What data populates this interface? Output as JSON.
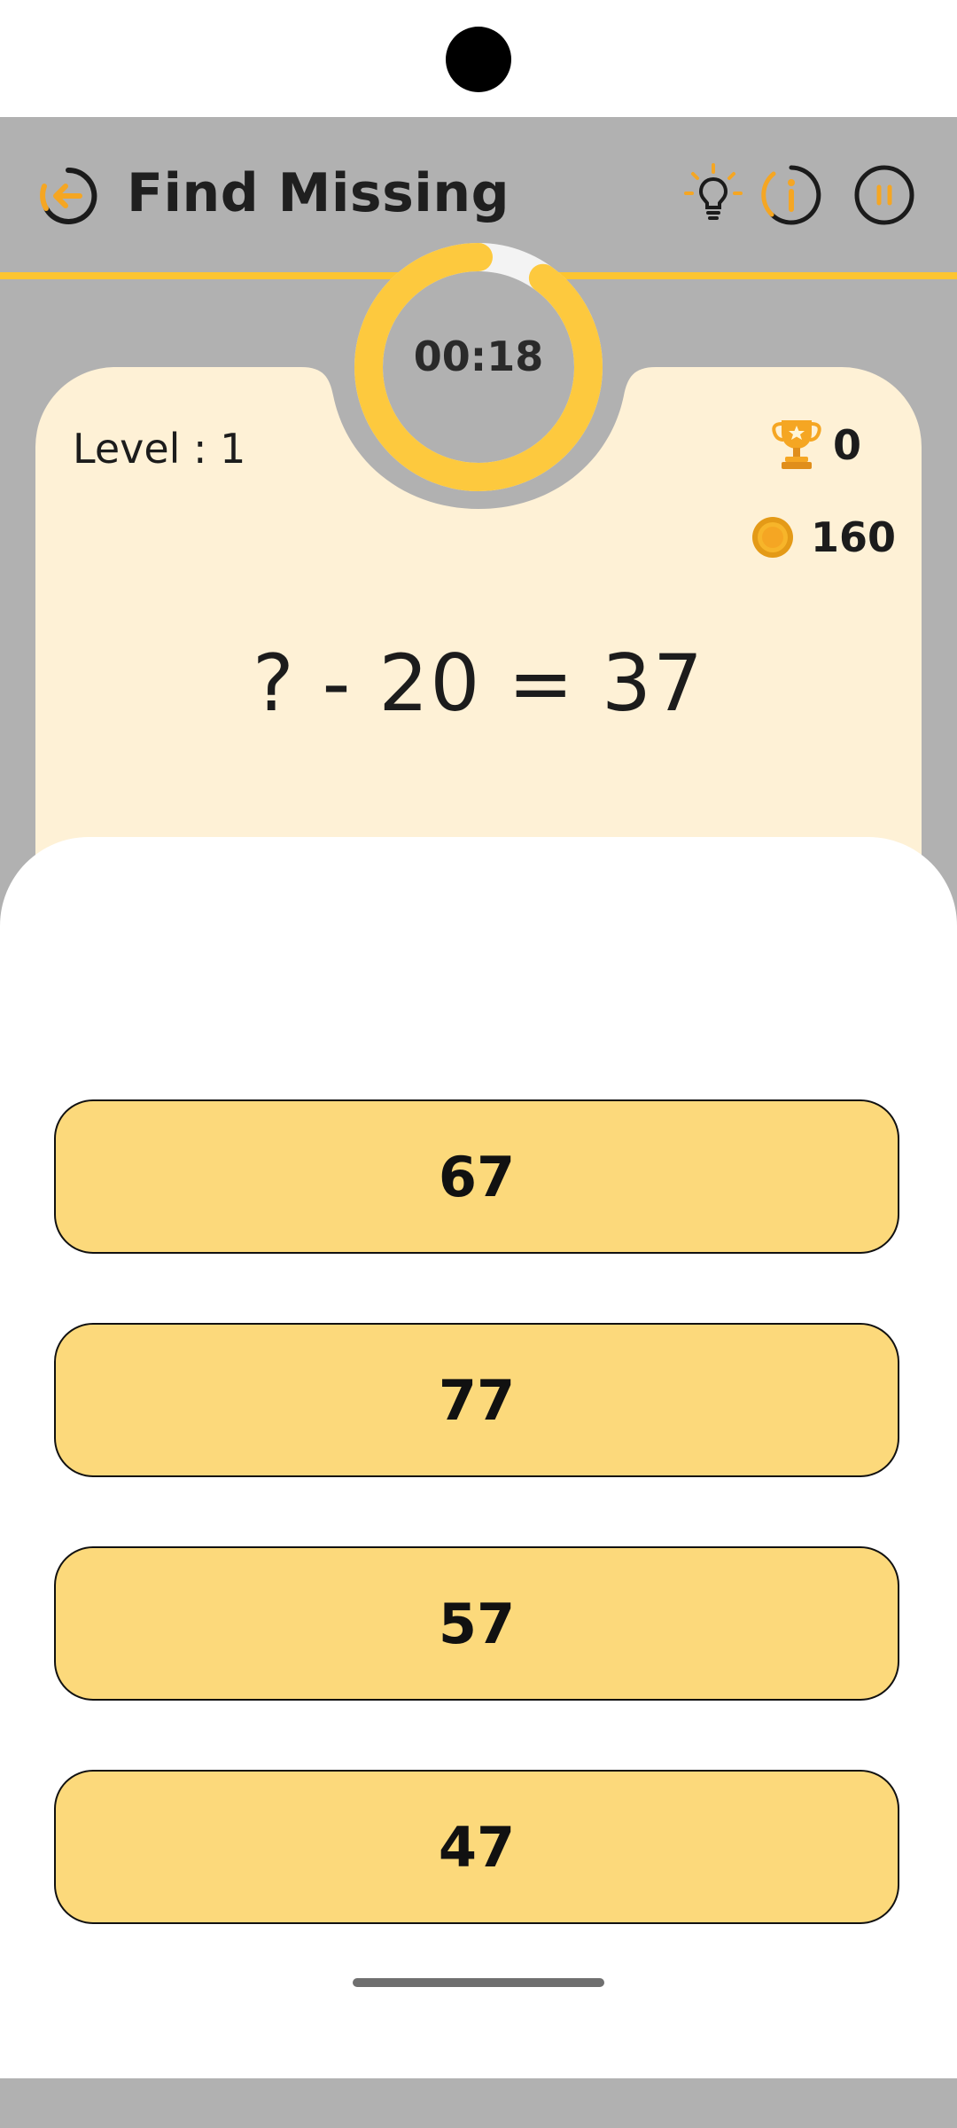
{
  "header": {
    "title": "Find Missing",
    "accent_color": "#fcc531",
    "icons": [
      "back-arrow-icon",
      "lightbulb-icon",
      "info-icon",
      "pause-icon"
    ]
  },
  "timer": {
    "time": "00:18",
    "progress_fraction": 0.9
  },
  "game": {
    "level_label": "Level : 1",
    "trophy_count": "0",
    "coin_count": "160",
    "equation": "? - 20 = 37"
  },
  "options": [
    {
      "label": "67"
    },
    {
      "label": "77"
    },
    {
      "label": "57"
    },
    {
      "label": "47"
    }
  ],
  "colors": {
    "background": "#b1b1b1",
    "card": "#fef1d6",
    "option": "#fcd97b",
    "timer_ring": "#fdc93e"
  }
}
